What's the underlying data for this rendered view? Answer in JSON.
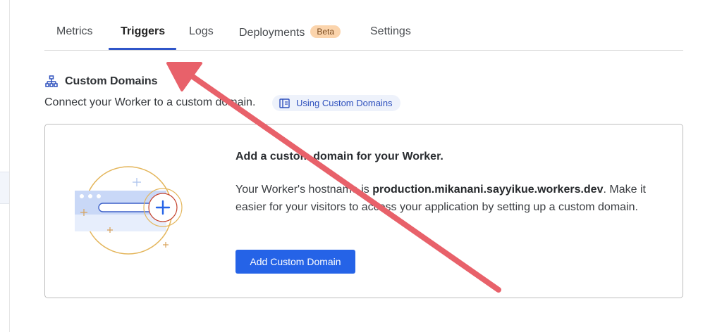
{
  "tabs": [
    {
      "label": "Metrics"
    },
    {
      "label": "Triggers",
      "active": true
    },
    {
      "label": "Logs"
    },
    {
      "label": "Deployments",
      "badge": "Beta"
    },
    {
      "label": "Settings"
    }
  ],
  "section": {
    "title": "Custom Domains",
    "icon": "sitemap-icon",
    "description": "Connect your Worker to a custom domain.",
    "doc_link": {
      "label": "Using Custom Domains",
      "icon": "book-icon"
    }
  },
  "card": {
    "heading": "Add a custom domain for your Worker.",
    "text_prefix": "Your Worker's hostname is ",
    "hostname": "production.mikanani.sayyikue.workers.dev",
    "text_suffix": ". Make it easier for your visitors to access your application by setting up a custom domain.",
    "button_label": "Add Custom Domain"
  },
  "colors": {
    "accent": "#2563e7",
    "tab_underline": "#2f55c9",
    "beta_badge": "#fbd4ac",
    "annotation_arrow": "#e8616a"
  }
}
